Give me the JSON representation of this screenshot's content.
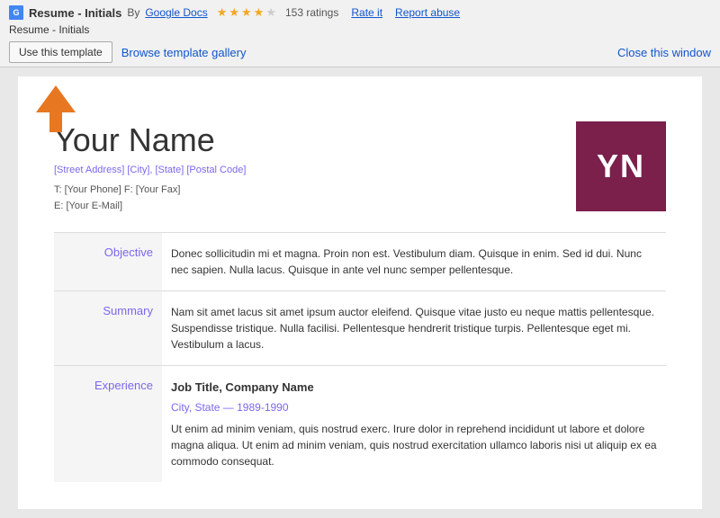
{
  "header": {
    "doc_icon_label": "G",
    "doc_title": "Resume - Initials",
    "by_label": "By",
    "author": "Google Docs",
    "ratings_count": "153 ratings",
    "rate_label": "Rate it",
    "report_label": "Report abuse",
    "subtitle": "Resume - Initials",
    "use_template_label": "Use this template",
    "browse_label": "Browse template gallery",
    "close_label": "Close this window"
  },
  "stars": {
    "filled": 4,
    "empty": 1
  },
  "preview": {
    "your_name": "Your Name",
    "address": "[Street Address] [City], [State] [Postal Code]",
    "phone_line": "T: [Your Phone]  F: [Your Fax]",
    "email_line": "E: [Your E-Mail]",
    "initials": "YN",
    "sections": [
      {
        "label": "Objective",
        "content": "Donec sollicitudin mi et magna. Proin non est. Vestibulum diam. Quisque in enim. Sed id dui. Nunc nec sapien. Nulla lacus. Quisque in ante vel nunc semper pellentesque.",
        "type": "text"
      },
      {
        "label": "Summary",
        "content": "Nam sit amet lacus sit amet ipsum auctor eleifend. Quisque vitae justo eu neque mattis pellentesque. Suspendisse tristique. Nulla facilisi. Pellentesque hendrerit tristique turpis. Pellentesque eget mi. Vestibulum a lacus.",
        "type": "text"
      },
      {
        "label": "Experience",
        "job_title": "Job Title, Company Name",
        "job_subtitle": "City, State — 1989-1990",
        "content": "Ut enim ad minim veniam, quis nostrud exerc. Irure dolor in reprehend incididunt ut labore et dolore magna aliqua. Ut enim ad minim veniam, quis nostrud exercitation ullamco laboris nisi ut aliquip ex ea commodo consequat.",
        "type": "job"
      }
    ]
  }
}
